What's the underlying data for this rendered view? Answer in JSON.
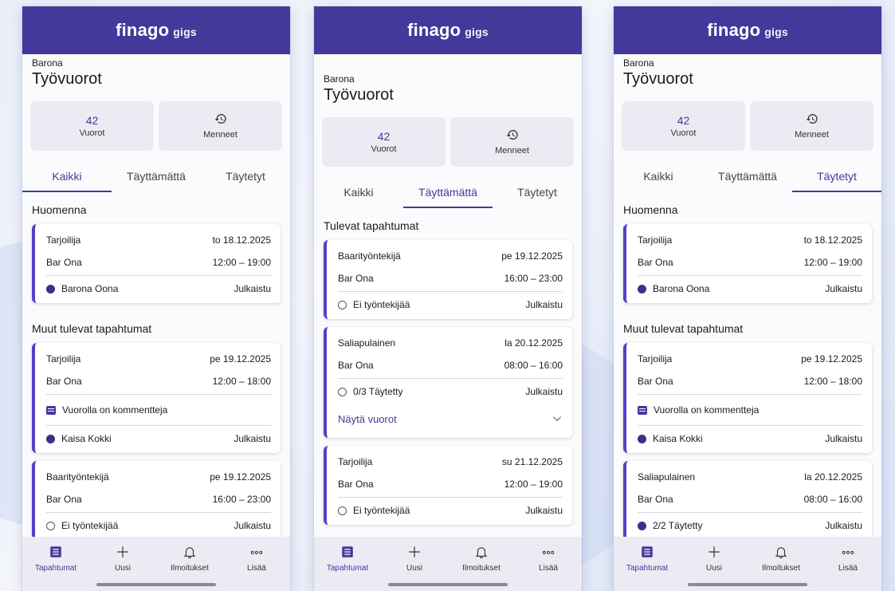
{
  "app": {
    "logo_main": "finago",
    "logo_sub": "gigs"
  },
  "colors": {
    "brand": "#45389b",
    "accent": "#5241c4",
    "nav_bg": "#eceaf3"
  },
  "nav": [
    {
      "label": "Tapahtumat",
      "icon": "list-icon"
    },
    {
      "label": "Uusi",
      "icon": "plus-icon"
    },
    {
      "label": "Ilmoitukset",
      "icon": "bell-icon"
    },
    {
      "label": "Lisää",
      "icon": "more-icon"
    }
  ],
  "screens": [
    {
      "org": "Barona",
      "title": "Työvuorot",
      "stats": {
        "count": "42",
        "count_label": "Vuorot",
        "past_label": "Menneet"
      },
      "tabs": [
        "Kaikki",
        "Täyttämättä",
        "Täytetyt"
      ],
      "active_tab": 0,
      "sections": [
        {
          "title": "Huomenna",
          "cards": [
            {
              "role": "Tarjoilija",
              "date": "to 18.12.2025",
              "venue": "Bar Ona",
              "time": "12:00 – 19:00",
              "worker": "Barona Oona",
              "status": "Julkaistu",
              "filled": true
            }
          ]
        },
        {
          "title": "Muut tulevat tapahtumat",
          "cards": [
            {
              "role": "Tarjoilija",
              "date": "pe 19.12.2025",
              "venue": "Bar Ona",
              "time": "12:00 – 18:00",
              "comment": "Vuorolla on kommentteja",
              "worker": "Kaisa Kokki",
              "status": "Julkaistu",
              "filled": true
            },
            {
              "role": "Baarityöntekijä",
              "date": "pe 19.12.2025",
              "venue": "Bar Ona",
              "time": "16:00 – 23:00",
              "worker": "Ei työntekijää",
              "status": "Julkaistu",
              "filled": false
            }
          ]
        }
      ]
    },
    {
      "org": "Barona",
      "title": "Työvuorot",
      "stats": {
        "count": "42",
        "count_label": "Vuorot",
        "past_label": "Menneet"
      },
      "tabs": [
        "Kaikki",
        "Täyttämättä",
        "Täytetyt"
      ],
      "active_tab": 1,
      "sections": [
        {
          "title": "Tulevat tapahtumat",
          "cards": [
            {
              "role": "Baarityöntekijä",
              "date": "pe 19.12.2025",
              "venue": "Bar Ona",
              "time": "16:00 – 23:00",
              "worker": "Ei työntekijää",
              "status": "Julkaistu",
              "filled": false
            },
            {
              "role": "Saliapulainen",
              "date": "la 20.12.2025",
              "venue": "Bar Ona",
              "time": "08:00 – 16:00",
              "worker": "0/3 Täytetty",
              "status": "Julkaistu",
              "filled": false,
              "expand": "Näytä vuorot"
            },
            {
              "role": "Tarjoilija",
              "date": "su 21.12.2025",
              "venue": "Bar Ona",
              "time": "12:00 – 19:00",
              "worker": "Ei työntekijää",
              "status": "Julkaistu",
              "filled": false
            }
          ]
        }
      ]
    },
    {
      "org": "Barona",
      "title": "Työvuorot",
      "stats": {
        "count": "42",
        "count_label": "Vuorot",
        "past_label": "Menneet"
      },
      "tabs": [
        "Kaikki",
        "Täyttämättä",
        "Täytetyt"
      ],
      "active_tab": 2,
      "sections": [
        {
          "title": "Huomenna",
          "cards": [
            {
              "role": "Tarjoilija",
              "date": "to 18.12.2025",
              "venue": "Bar Ona",
              "time": "12:00 – 19:00",
              "worker": "Barona Oona",
              "status": "Julkaistu",
              "filled": true
            }
          ]
        },
        {
          "title": "Muut tulevat tapahtumat",
          "cards": [
            {
              "role": "Tarjoilija",
              "date": "pe 19.12.2025",
              "venue": "Bar Ona",
              "time": "12:00 – 18:00",
              "comment": "Vuorolla on kommentteja",
              "worker": "Kaisa Kokki",
              "status": "Julkaistu",
              "filled": true
            },
            {
              "role": "Saliapulainen",
              "date": "la 20.12.2025",
              "venue": "Bar Ona",
              "time": "08:00 – 16:00",
              "worker": "2/2 Täytetty",
              "status": "Julkaistu",
              "filled": true
            }
          ]
        }
      ]
    }
  ]
}
